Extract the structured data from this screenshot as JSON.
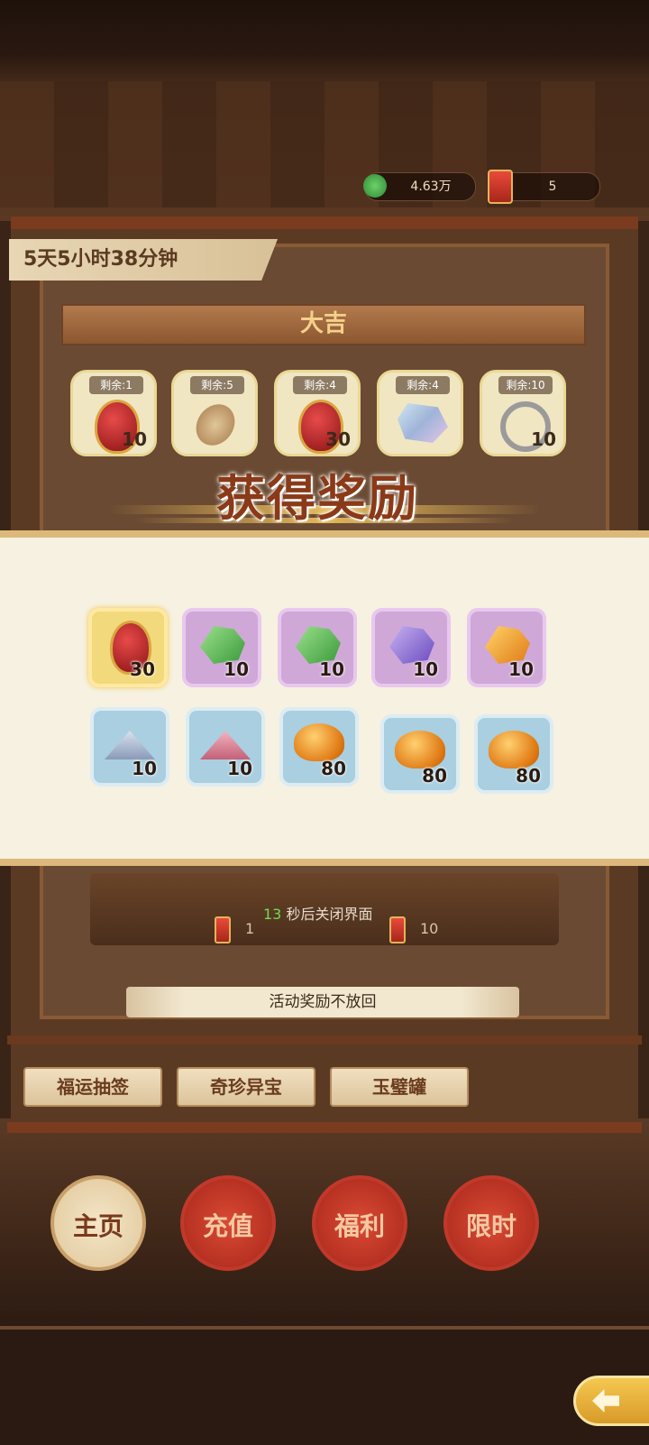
{
  "currency": [
    {
      "icon": "jade-coin-icon",
      "value": "4.63万"
    },
    {
      "icon": "lantern-token-icon",
      "value": "5"
    }
  ],
  "timer": "5天5小时38分钟",
  "pool": {
    "title": "大吉",
    "items": [
      {
        "remain": "剩余:1",
        "qty": "10",
        "icon": "red-gem-pendant-icon"
      },
      {
        "remain": "剩余:5",
        "qty": "",
        "icon": "pipa-lute-icon"
      },
      {
        "remain": "剩余:4",
        "qty": "30",
        "icon": "red-gem-pendant-icon"
      },
      {
        "remain": "剩余:4",
        "qty": "",
        "icon": "crystal-ore-icon"
      },
      {
        "remain": "剩余:10",
        "qty": "10",
        "icon": "silver-bracelet-icon"
      }
    ]
  },
  "reward_modal": {
    "title": "获得奖励",
    "rows": [
      [
        {
          "rarity": "gold",
          "icon": "red-gem-pendant-icon",
          "qty": "30"
        },
        {
          "rarity": "purple",
          "icon": "green-jade-ore-icon",
          "qty": "10"
        },
        {
          "rarity": "purple",
          "icon": "green-jade-ore-icon",
          "qty": "10"
        },
        {
          "rarity": "purple",
          "icon": "purple-crystal-ore-icon",
          "qty": "10"
        },
        {
          "rarity": "purple",
          "icon": "amber-ore-icon",
          "qty": "10"
        }
      ],
      [
        {
          "rarity": "blue",
          "icon": "silver-sand-icon",
          "qty": "10"
        },
        {
          "rarity": "blue",
          "icon": "rose-sand-icon",
          "qty": "10"
        },
        {
          "rarity": "blue",
          "icon": "amber-stone-icon",
          "qty": "80"
        },
        {
          "rarity": "blue",
          "icon": "amber-stone-icon",
          "qty": "80"
        },
        {
          "rarity": "blue",
          "icon": "amber-stone-icon",
          "qty": "80"
        }
      ]
    ]
  },
  "countdown": {
    "seconds": "13",
    "text": "秒后关闭界面"
  },
  "draw_costs": [
    "1",
    "10"
  ],
  "notice": "活动奖励不放回",
  "tabs": [
    "福运抽签",
    "奇珍异宝",
    "玉璧罐"
  ],
  "nav": [
    "主页",
    "充值",
    "福利",
    "限时"
  ],
  "colors": {
    "modal_bg": "#f6f1e1",
    "gold_frame": "#f2d97c",
    "purple_frame": "#cfa8d8",
    "blue_frame": "#a9cfe0",
    "title": "#8a3a18"
  }
}
